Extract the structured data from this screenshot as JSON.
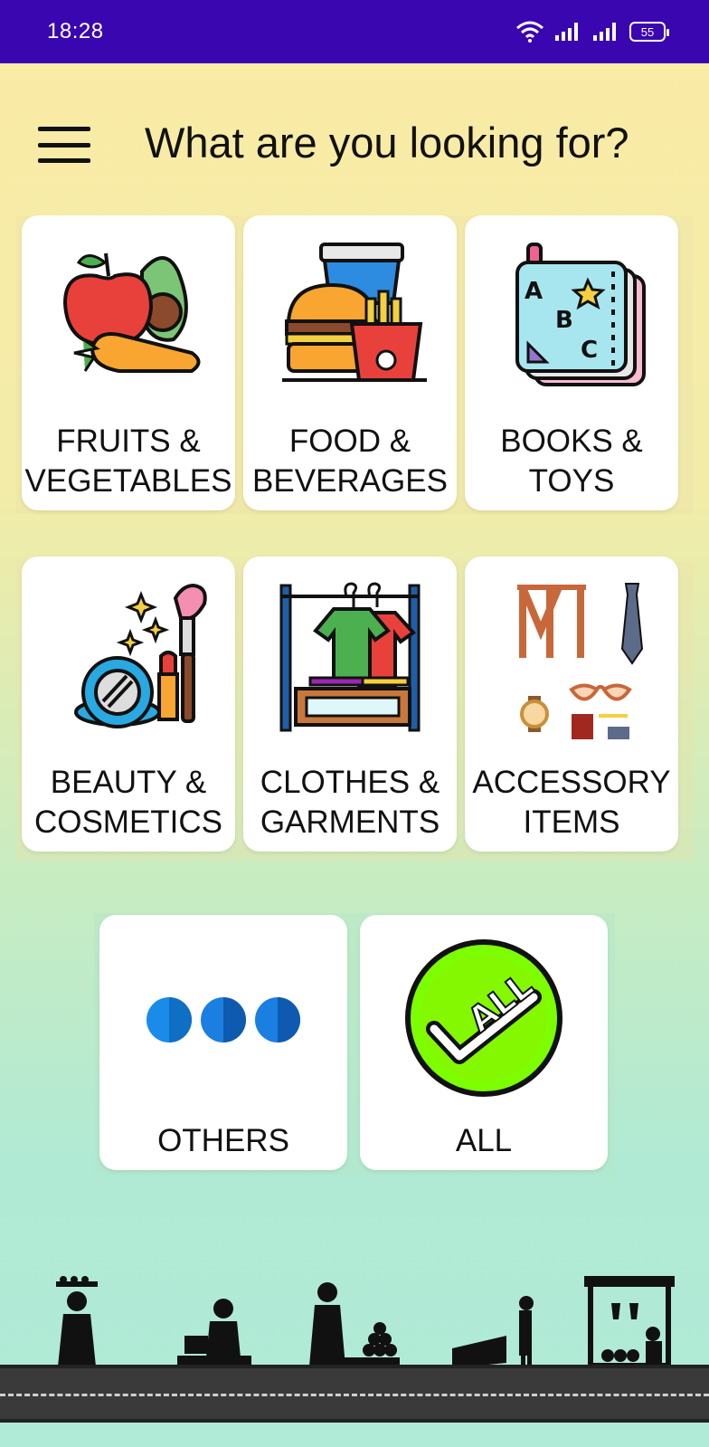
{
  "status_bar": {
    "time": "18:28",
    "battery": "55",
    "icons": [
      "wifi-icon",
      "signal-icon",
      "signal-icon",
      "battery-icon"
    ]
  },
  "header": {
    "title": "What are you looking for?",
    "menu_icon": "hamburger-menu-icon"
  },
  "categories": [
    {
      "label": "FRUITS &\nVEGETABLES",
      "icon": "fruits-vegetables-icon"
    },
    {
      "label": "FOOD &\nBEVERAGES",
      "icon": "food-beverages-icon"
    },
    {
      "label": "BOOKS &\nTOYS",
      "icon": "books-toys-icon"
    },
    {
      "label": "BEAUTY &\nCOSMETICS",
      "icon": "beauty-cosmetics-icon"
    },
    {
      "label": "CLOTHES &\nGARMENTS",
      "icon": "clothes-garments-icon"
    },
    {
      "label": "ACCESSORY\nITEMS",
      "icon": "accessory-items-icon"
    },
    {
      "label": "OTHERS",
      "icon": "more-dots-icon"
    },
    {
      "label": "ALL",
      "icon": "all-check-icon"
    }
  ],
  "colors": {
    "status_bar": "#3a06b0",
    "all_badge": "#7cff00",
    "dots": "#1a7fe0"
  }
}
